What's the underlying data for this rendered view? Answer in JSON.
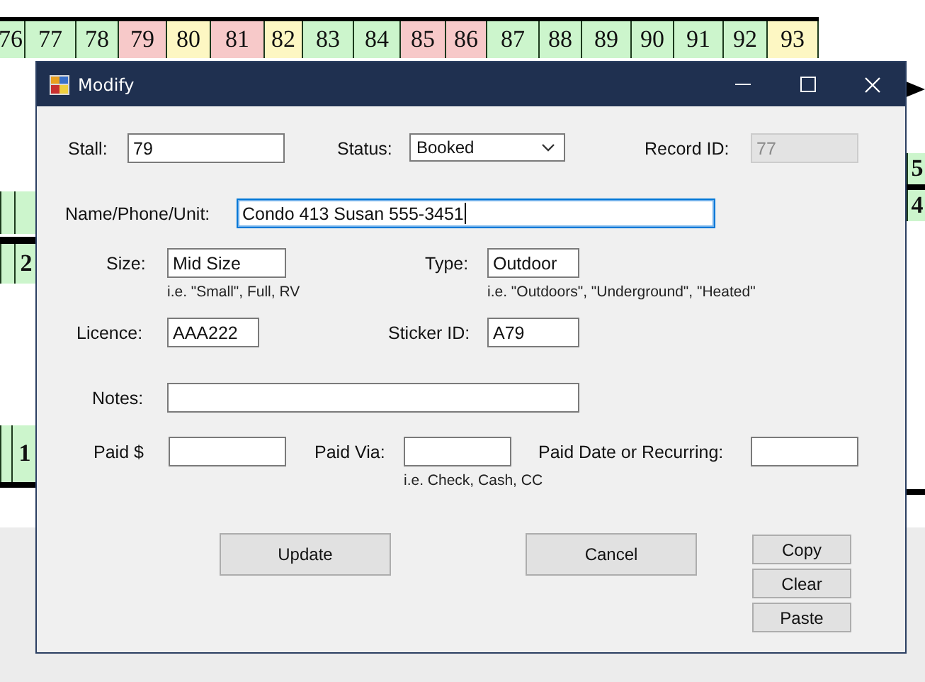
{
  "background": {
    "top_row": [
      {
        "label": "76",
        "color": "#ccf5cc"
      },
      {
        "label": "77",
        "color": "#ccf5cc"
      },
      {
        "label": "78",
        "color": "#ccf5cc"
      },
      {
        "label": "79",
        "color": "#f7c9c9"
      },
      {
        "label": "80",
        "color": "#fdf7c3"
      },
      {
        "label": "81",
        "color": "#f7c9c9"
      },
      {
        "label": "82",
        "color": "#fdf7c3"
      },
      {
        "label": "83",
        "color": "#ccf5cc"
      },
      {
        "label": "84",
        "color": "#ccf5cc"
      },
      {
        "label": "85",
        "color": "#f7c9c9"
      },
      {
        "label": "86",
        "color": "#f7c9c9"
      },
      {
        "label": "87",
        "color": "#ccf5cc"
      },
      {
        "label": "88",
        "color": "#ccf5cc"
      },
      {
        "label": "89",
        "color": "#ccf5cc"
      },
      {
        "label": "90",
        "color": "#ccf5cc"
      },
      {
        "label": "91",
        "color": "#ccf5cc"
      },
      {
        "label": "92",
        "color": "#ccf5cc"
      },
      {
        "label": "93",
        "color": "#fdf7c3"
      }
    ],
    "edge_cells": [
      {
        "color": "#ccf5cc"
      },
      {
        "color": "#ccf5cc"
      },
      {
        "color": "#ccf5cc"
      },
      {
        "label": "2",
        "color": "#ccf5cc"
      },
      {
        "color": "#ccf5cc"
      },
      {
        "label": "1",
        "color": "#ccf5cc"
      },
      {
        "label": "5",
        "color": "#ccf5cc"
      },
      {
        "label": "4",
        "color": "#ccf5cc"
      }
    ]
  },
  "window": {
    "title": "Modify"
  },
  "rows": [
    [
      {
        "kind": "text",
        "label": "Stall:",
        "value": "79",
        "disabled": false,
        "focused": false
      },
      {
        "kind": "combo",
        "label": "Status:",
        "value": "Booked",
        "disabled": false,
        "focused": false
      },
      {
        "kind": "text",
        "label": "Record ID:",
        "value": "77",
        "disabled": true,
        "focused": false
      }
    ],
    [
      {
        "kind": "text",
        "label": "Name/Phone/Unit:",
        "value": "Condo 413 Susan 555-3451",
        "disabled": false,
        "focused": true
      }
    ],
    [
      {
        "kind": "text",
        "label": "Size:",
        "value": "Mid Size",
        "hint": "i.e. \"Small\", Full, RV",
        "disabled": false,
        "focused": false
      },
      {
        "kind": "text",
        "label": "Type:",
        "value": "Outdoor",
        "hint": "i.e. \"Outdoors\", \"Underground\", \"Heated\"",
        "disabled": false,
        "focused": false
      }
    ],
    [
      {
        "kind": "text",
        "label": "Licence:",
        "value": "AAA222",
        "disabled": false,
        "focused": false
      },
      {
        "kind": "text",
        "label": "Sticker ID:",
        "value": "A79",
        "disabled": false,
        "focused": false
      }
    ],
    [
      {
        "kind": "text",
        "label": "Notes:",
        "disabled": false,
        "focused": false
      }
    ],
    [
      {
        "kind": "text",
        "label": "Paid $",
        "disabled": false,
        "focused": false
      },
      {
        "kind": "text",
        "label": "Paid Via:",
        "hint": "i.e. Check, Cash, CC",
        "disabled": false,
        "focused": false
      },
      {
        "kind": "text",
        "label": "Paid Date or Recurring:",
        "disabled": false,
        "focused": false
      }
    ]
  ],
  "buttons": {
    "main": [
      "Update",
      "Cancel"
    ],
    "side": [
      "Copy",
      "Clear",
      "Paste"
    ]
  }
}
